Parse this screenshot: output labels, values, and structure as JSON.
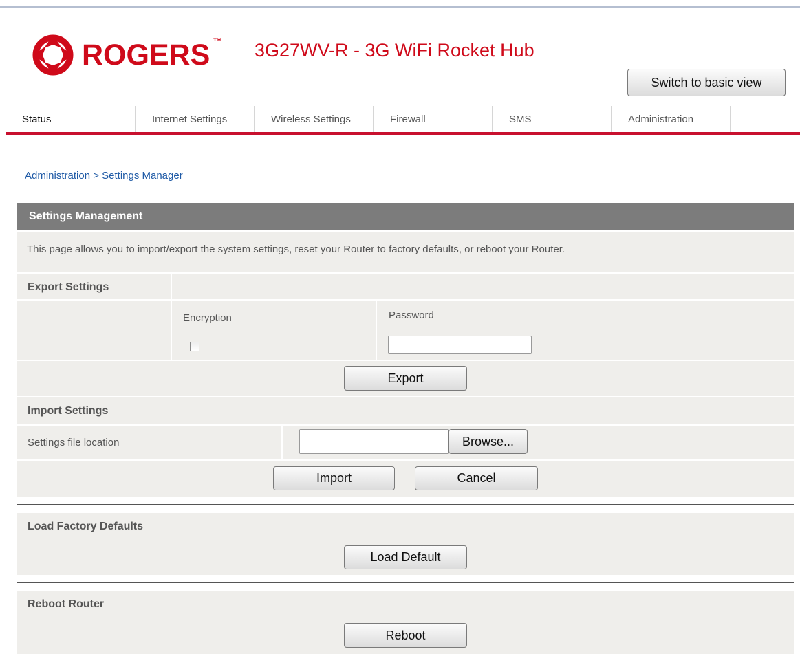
{
  "brand": {
    "name": "ROGERS",
    "trademark": "™",
    "product_title": "3G27WV-R - 3G WiFi Rocket Hub",
    "color": "#cf0a1a"
  },
  "header": {
    "switch_view_label": "Switch to basic view"
  },
  "nav": {
    "tabs": [
      {
        "label": "Status",
        "active": true
      },
      {
        "label": "Internet Settings",
        "active": false
      },
      {
        "label": "Wireless Settings",
        "active": false
      },
      {
        "label": "Firewall",
        "active": false
      },
      {
        "label": "SMS",
        "active": false
      },
      {
        "label": "Administration",
        "active": false
      }
    ],
    "accent_color": "#c8102e"
  },
  "breadcrumb": "Administration > Settings Manager",
  "panel": {
    "title": "Settings Management",
    "description": "This page allows you to import/export the system settings, reset your Router to factory defaults, or reboot your Router."
  },
  "export": {
    "title": "Export Settings",
    "encryption_label": "Encryption",
    "encryption_checked": false,
    "password_label": "Password",
    "password_value": "",
    "button_label": "Export"
  },
  "import": {
    "title": "Import Settings",
    "file_location_label": "Settings file location",
    "file_value": "",
    "browse_label": "Browse...",
    "import_label": "Import",
    "cancel_label": "Cancel"
  },
  "factory": {
    "title": "Load Factory Defaults",
    "button_label": "Load Default"
  },
  "reboot": {
    "title": "Reboot Router",
    "button_label": "Reboot"
  }
}
